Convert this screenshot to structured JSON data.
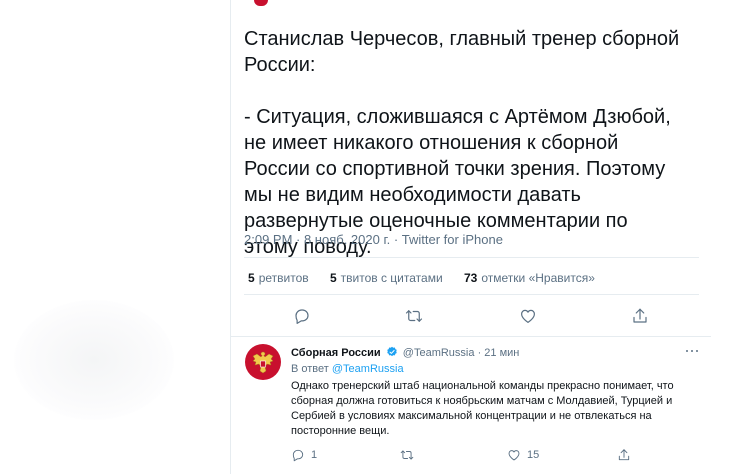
{
  "tweet": {
    "text_line1": "Станислав Черчесов, главный тренер сборной России:",
    "text_line2": "- Ситуация, сложившаяся с Артёмом Дзюбой, не имеет никакого отношения к сборной России со спортивной точки зрения. Поэтому мы не видим необходимости давать развернутые оценочные комментарии по этому поводу.",
    "meta": "2:09 PM · 8 нояб. 2020 г. · Twitter for iPhone",
    "stats": {
      "retweets_count": "5",
      "retweets_label": "ретвитов",
      "quotes_count": "5",
      "quotes_label": "твитов с цитатами",
      "likes_count": "73",
      "likes_label": "отметки «Нравится»"
    },
    "actions": [
      "reply-icon",
      "retweet-icon",
      "like-icon",
      "share-icon"
    ]
  },
  "reply": {
    "display_name": "Сборная России",
    "handle": "@TeamRussia",
    "time": "· 21 мин",
    "reply_to_prefix": "В ответ",
    "reply_to_handle": "@TeamRussia",
    "text": "Однако тренерский штаб национальной команды прекрасно понимает, что сборная должна готовиться к ноябрьским матчам с Молдавией, Турцией и Сербией в условиях максимальной концентрации и не отвлекаться на посторонние вещи.",
    "reply_count": "1",
    "retweet_count": "",
    "like_count": "15"
  },
  "colors": {
    "accent": "#1da1f2",
    "secondary_text": "#5b7083",
    "brand_red": "#c8102e",
    "divider": "#e6ecf0"
  }
}
